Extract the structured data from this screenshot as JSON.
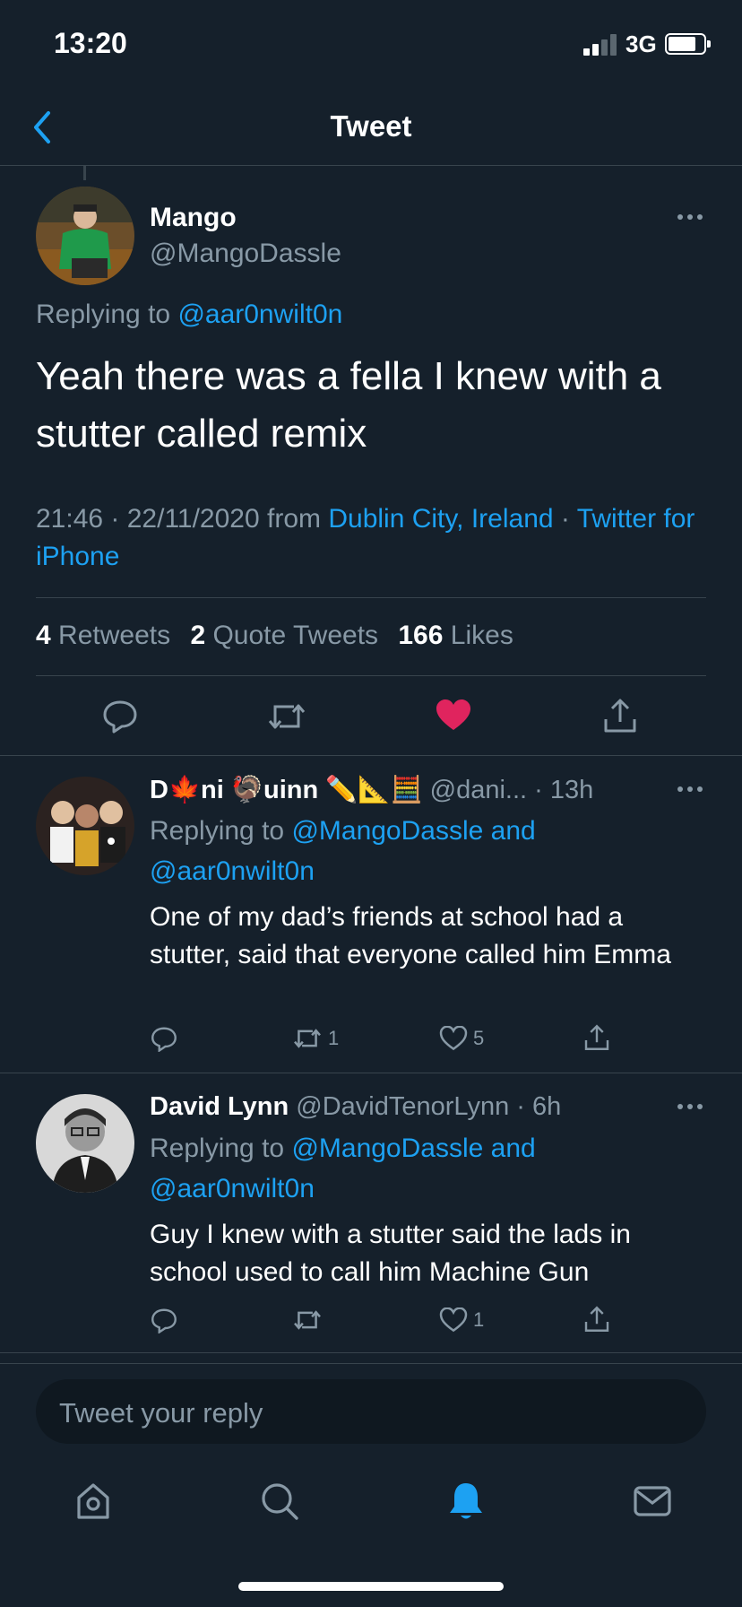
{
  "status": {
    "time": "13:20",
    "network": "3G"
  },
  "nav": {
    "title": "Tweet"
  },
  "main_tweet": {
    "name": "Mango",
    "handle": "@MangoDassle",
    "replying_prefix": "Replying to",
    "replying_to": "@aar0nwilt0n",
    "text": "Yeah there was a fella I knew with a stutter called remix",
    "time": "21:46 · 22/11/2020 from",
    "location": "Dublin City, Ireland",
    "sep": "·",
    "client": "Twitter for iPhone",
    "retweets": "4",
    "retweets_label": "Retweets",
    "quotes": "2",
    "quotes_label": "Quote Tweets",
    "likes": "166",
    "likes_label": "Likes",
    "liked": true
  },
  "replies": [
    {
      "name": "D🍁ni 🦃uinn ✏️📐🧮",
      "handle": "@dani...",
      "time": "· 13h",
      "replying_prefix": "Replying to",
      "replying_to": "@MangoDassle and @aar0nwilt0n",
      "text": "One of my dad’s friends at school had a stutter, said that everyone called him Emma",
      "retweets": "1",
      "likes": "5"
    },
    {
      "name": "David Lynn",
      "handle": "@DavidTenorLynn",
      "time": "· 6h",
      "replying_prefix": "Replying to",
      "replying_to": "@MangoDassle and @aar0nwilt0n",
      "text": "Guy I knew with a stutter said the lads in school used to call him Machine Gun",
      "retweets": "",
      "likes": "1"
    }
  ],
  "compose": {
    "placeholder": "Tweet your reply"
  },
  "tabs": [
    "home-icon",
    "search-icon",
    "notifications-icon",
    "messages-icon"
  ],
  "colors": {
    "background": "#15202b",
    "accent": "#1da1f2",
    "like": "#e0245e",
    "muted": "#8899a6"
  }
}
